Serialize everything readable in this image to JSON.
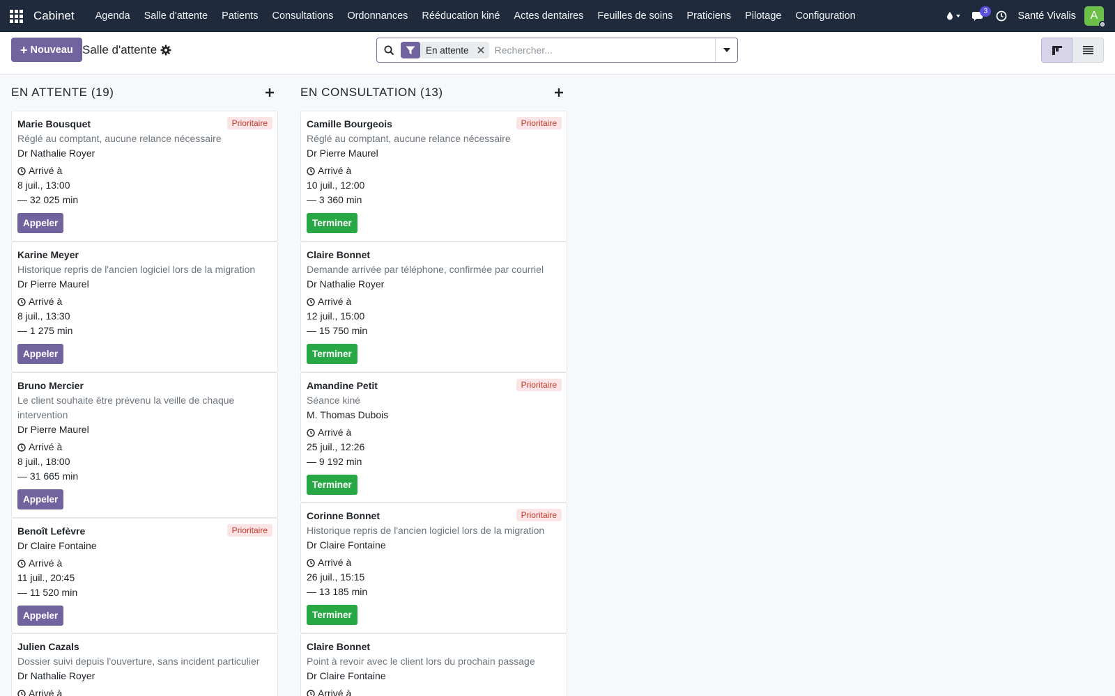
{
  "navbar": {
    "brand": "Cabinet",
    "menu": [
      "Agenda",
      "Salle d'attente",
      "Patients",
      "Consultations",
      "Ordonnances",
      "Rééducation kiné",
      "Actes dentaires",
      "Feuilles de soins",
      "Praticiens",
      "Pilotage",
      "Configuration"
    ],
    "chat_badge": "3",
    "company": "Santé Vivalis",
    "avatar_letter": "A",
    "icons": [
      "apps-grid-icon",
      "drop-icon",
      "chat-icon",
      "clock-icon"
    ]
  },
  "control": {
    "new_label": "Nouveau",
    "page_title": "Salle d'attente",
    "facet_label": "En attente",
    "search_placeholder": "Rechercher..."
  },
  "colors": {
    "navbar": "#1f2a3d",
    "primary": "#71639e",
    "success": "#28a745",
    "priority_bg": "#fbe4e6",
    "priority_text": "#c0392b"
  },
  "columns": [
    {
      "title": "EN ATTENTE (19)",
      "cards": [
        {
          "name": "Marie Bousquet",
          "priority": "Prioritaire",
          "note": "Réglé au comptant, aucune relance nécessaire",
          "doctor": "Dr Nathalie Royer",
          "arrived_label": "Arrivé à",
          "arrived_at": "8 juil., 13:00",
          "wait": "— 32 025 min",
          "action": "Appeler"
        },
        {
          "name": "Karine Meyer",
          "priority": "",
          "note": "Historique repris de l'ancien logiciel lors de la migration",
          "doctor": "Dr Pierre Maurel",
          "arrived_label": "Arrivé à",
          "arrived_at": "8 juil., 13:30",
          "wait": "— 1 275 min",
          "action": "Appeler"
        },
        {
          "name": "Bruno Mercier",
          "priority": "",
          "note": "Le client souhaite être prévenu la veille de chaque intervention",
          "doctor": "Dr Pierre Maurel",
          "arrived_label": "Arrivé à",
          "arrived_at": "8 juil., 18:00",
          "wait": "— 31 665 min",
          "action": "Appeler"
        },
        {
          "name": "Benoît Lefèvre",
          "priority": "Prioritaire",
          "note": "",
          "doctor": "Dr Claire Fontaine",
          "arrived_label": "Arrivé à",
          "arrived_at": "11 juil., 20:45",
          "wait": "— 11 520 min",
          "action": "Appeler"
        },
        {
          "name": "Julien Cazals",
          "priority": "",
          "note": "Dossier suivi depuis l'ouverture, sans incident particulier",
          "doctor": "Dr Nathalie Royer",
          "arrived_label": "Arrivé à",
          "arrived_at": "",
          "wait": "",
          "action": ""
        }
      ]
    },
    {
      "title": "EN CONSULTATION (13)",
      "cards": [
        {
          "name": "Camille Bourgeois",
          "priority": "Prioritaire",
          "note": "Réglé au comptant, aucune relance nécessaire",
          "doctor": "Dr Pierre Maurel",
          "arrived_label": "Arrivé à",
          "arrived_at": "10 juil., 12:00",
          "wait": "— 3 360 min",
          "action": "Terminer"
        },
        {
          "name": "Claire Bonnet",
          "priority": "",
          "note": "Demande arrivée par téléphone, confirmée par courriel",
          "doctor": "Dr Nathalie Royer",
          "arrived_label": "Arrivé à",
          "arrived_at": "12 juil., 15:00",
          "wait": "— 15 750 min",
          "action": "Terminer"
        },
        {
          "name": "Amandine Petit",
          "priority": "Prioritaire",
          "note": "Séance kiné",
          "doctor": "M. Thomas Dubois",
          "arrived_label": "Arrivé à",
          "arrived_at": "25 juil., 12:26",
          "wait": "— 9 192 min",
          "action": "Terminer"
        },
        {
          "name": "Corinne Bonnet",
          "priority": "Prioritaire",
          "note": "Historique repris de l'ancien logiciel lors de la migration",
          "doctor": "Dr Claire Fontaine",
          "arrived_label": "Arrivé à",
          "arrived_at": "26 juil., 15:15",
          "wait": "— 13 185 min",
          "action": "Terminer"
        },
        {
          "name": "Claire Bonnet",
          "priority": "",
          "note": "Point à revoir avec le client lors du prochain passage",
          "doctor": "Dr Claire Fontaine",
          "arrived_label": "Arrivé à",
          "arrived_at": "",
          "wait": "",
          "action": ""
        }
      ]
    }
  ]
}
